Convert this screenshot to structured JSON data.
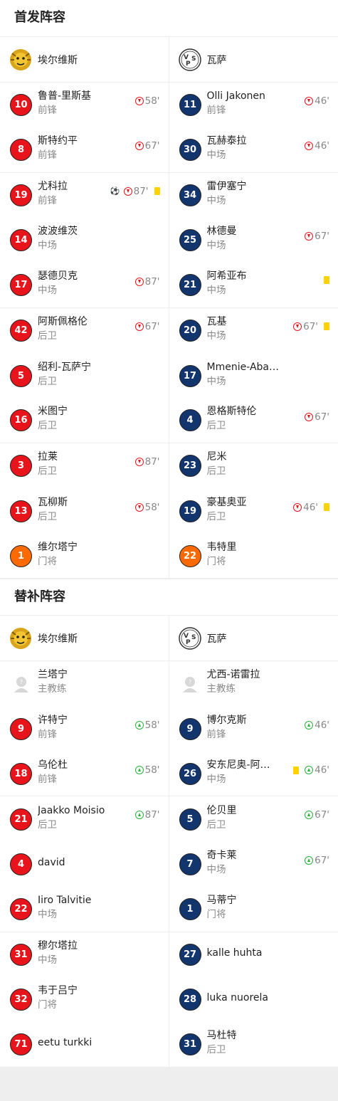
{
  "starting": {
    "title": "首发阵容",
    "home": {
      "name": "埃尔维斯",
      "players": [
        {
          "num": "10",
          "name": "鲁普-里斯基",
          "pos": "前锋",
          "out": "58'"
        },
        {
          "num": "8",
          "name": "斯特约平",
          "pos": "前锋",
          "out": "67'"
        },
        {
          "num": "19",
          "name": "尤科拉",
          "pos": "前锋",
          "goal": true,
          "out": "87'",
          "card": "yellow"
        },
        {
          "num": "14",
          "name": "波波维茨",
          "pos": "中场"
        },
        {
          "num": "17",
          "name": "瑟德贝克",
          "pos": "中场",
          "out": "87'"
        },
        {
          "num": "42",
          "name": "阿斯佩格伦",
          "pos": "后卫",
          "out": "67'"
        },
        {
          "num": "5",
          "name": "绍利-瓦萨宁",
          "pos": "后卫"
        },
        {
          "num": "16",
          "name": "米图宁",
          "pos": "后卫"
        },
        {
          "num": "3",
          "name": "拉莱",
          "pos": "后卫",
          "out": "87'"
        },
        {
          "num": "13",
          "name": "瓦柳斯",
          "pos": "后卫",
          "out": "58'"
        },
        {
          "num": "1",
          "name": "维尔塔宁",
          "pos": "门将",
          "keeper": true
        }
      ]
    },
    "away": {
      "name": "瓦萨",
      "players": [
        {
          "num": "11",
          "name": "Olli Jakonen",
          "pos": "前锋",
          "out": "46'"
        },
        {
          "num": "30",
          "name": "瓦赫泰拉",
          "pos": "中场",
          "out": "46'"
        },
        {
          "num": "34",
          "name": "雷伊塞宁",
          "pos": "中场"
        },
        {
          "num": "25",
          "name": "林德曼",
          "pos": "中场",
          "out": "67'"
        },
        {
          "num": "21",
          "name": "阿希亚布",
          "pos": "中场",
          "card": "yellow"
        },
        {
          "num": "20",
          "name": "瓦基",
          "pos": "中场",
          "out": "67'",
          "card": "yellow"
        },
        {
          "num": "17",
          "name": "Mmenie-Aba…",
          "pos": "中场"
        },
        {
          "num": "4",
          "name": "恩格斯特伦",
          "pos": "后卫",
          "out": "67'"
        },
        {
          "num": "23",
          "name": "尼米",
          "pos": "后卫"
        },
        {
          "num": "19",
          "name": "豪基奥亚",
          "pos": "后卫",
          "out": "46'",
          "card": "yellow"
        },
        {
          "num": "22",
          "name": "韦特里",
          "pos": "门将",
          "keeper": true
        }
      ]
    }
  },
  "subs": {
    "title": "替补阵容",
    "home": {
      "name": "埃尔维斯",
      "coach": {
        "name": "兰塔宁",
        "role": "主教练"
      },
      "players": [
        {
          "num": "9",
          "name": "许特宁",
          "pos": "前锋",
          "in": "58'"
        },
        {
          "num": "18",
          "name": "乌伦杜",
          "pos": "前锋",
          "in": "58'"
        },
        {
          "num": "21",
          "name": "Jaakko Moisio",
          "pos": "后卫",
          "in": "87'"
        },
        {
          "num": "4",
          "name": "david",
          "pos": ""
        },
        {
          "num": "22",
          "name": "Iiro Talvitie",
          "pos": "中场"
        },
        {
          "num": "31",
          "name": "穆尔塔拉",
          "pos": "中场"
        },
        {
          "num": "32",
          "name": "韦于吕宁",
          "pos": "门将"
        },
        {
          "num": "71",
          "name": "eetu turkki",
          "pos": ""
        }
      ]
    },
    "away": {
      "name": "瓦萨",
      "coach": {
        "name": "尤西-诺雷拉",
        "role": "主教练"
      },
      "players": [
        {
          "num": "9",
          "name": "博尔克斯",
          "pos": "前锋",
          "in": "46'"
        },
        {
          "num": "26",
          "name": "安东尼奥-阿…",
          "pos": "中场",
          "card": "yellow",
          "in": "46'"
        },
        {
          "num": "5",
          "name": "伦贝里",
          "pos": "后卫",
          "in": "67'"
        },
        {
          "num": "7",
          "name": "奇卡莱",
          "pos": "中场",
          "in": "67'"
        },
        {
          "num": "1",
          "name": "马蒂宁",
          "pos": "门将"
        },
        {
          "num": "27",
          "name": "kalle huhta",
          "pos": ""
        },
        {
          "num": "28",
          "name": "luka nuorela",
          "pos": ""
        },
        {
          "num": "31",
          "name": "马杜特",
          "pos": "后卫"
        }
      ]
    }
  },
  "colors": {
    "home": "#e8141b",
    "keeper": "#ff6a00",
    "away": "#12356e",
    "card": "#ffd200",
    "sub_in": "#27b33a",
    "sub_out": "#e8141b"
  },
  "icons": {
    "home_logo": "lion-crest-icon",
    "away_logo": "vps-crest-icon",
    "coach": "person-placeholder-icon"
  }
}
